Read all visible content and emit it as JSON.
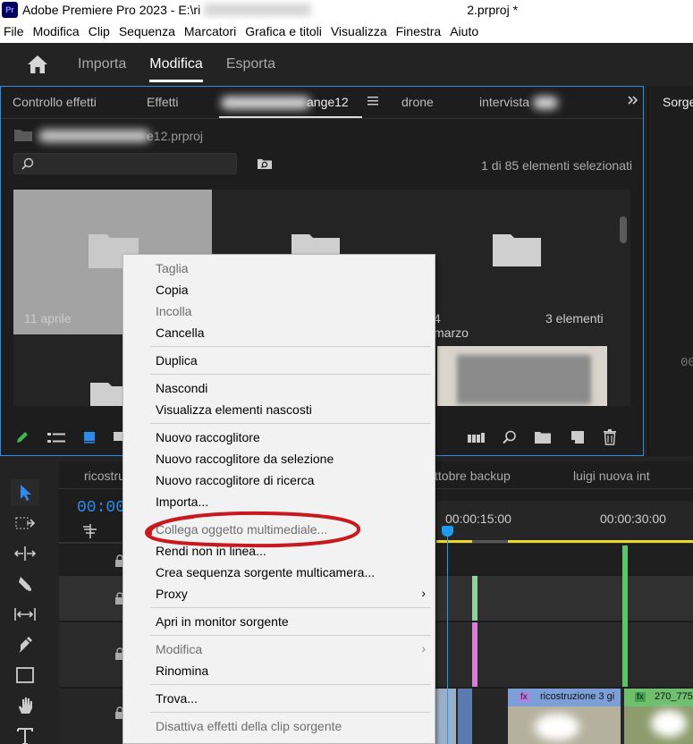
{
  "titlebar": {
    "app_title": "Adobe Premiere Pro 2023 - E:\\ri",
    "suffix": "2.prproj *"
  },
  "menubar": {
    "items": [
      "File",
      "Modifica",
      "Clip",
      "Sequenza",
      "Marcatori",
      "Grafica e titoli",
      "Visualizza",
      "Finestra",
      "Aiuto"
    ]
  },
  "workspace": {
    "tabs": [
      "Importa",
      "Modifica",
      "Esporta"
    ],
    "active": "Modifica"
  },
  "project_panel": {
    "tabs": [
      "Controllo effetti",
      "Effetti",
      "ange12",
      "drone",
      "intervista"
    ],
    "project_file": "e12.prproj",
    "selection_count": "1 di 85 elementi selezionati",
    "bins": [
      {
        "label": "11 aprile"
      },
      {
        "label": "4 marzo"
      },
      {
        "label": "3 elementi"
      }
    ]
  },
  "source_panel": {
    "title": "Sorge",
    "timecode": "00"
  },
  "timeline": {
    "tabs": [
      "ricostru",
      "ttobre backup",
      "luigi nuova int"
    ],
    "timecode": "00:00",
    "ruler_marks": [
      "00:00:15:00",
      "00:00:30:00"
    ],
    "clips": [
      {
        "label": "ricostruzione 3 gi",
        "badge": "fx"
      },
      {
        "label": "270_775",
        "badge": "fx"
      }
    ]
  },
  "context_menu": {
    "items": {
      "taglia": "Taglia",
      "copia": "Copia",
      "incolla": "Incolla",
      "cancella": "Cancella",
      "duplica": "Duplica",
      "nascondi": "Nascondi",
      "visualizza_nascosti": "Visualizza elementi nascosti",
      "nuovo_raccoglitore": "Nuovo raccoglitore",
      "nuovo_raccoglitore_selezione": "Nuovo raccoglitore da selezione",
      "nuovo_raccoglitore_ricerca": "Nuovo raccoglitore di ricerca",
      "importa": "Importa...",
      "collega": "Collega oggetto multimediale...",
      "rendi_non_in_linea": "Rendi non in linea...",
      "crea_multicamera": "Crea sequenza sorgente multicamera...",
      "proxy": "Proxy",
      "apri_monitor": "Apri in monitor sorgente",
      "modifica": "Modifica",
      "rinomina": "Rinomina",
      "trova": "Trova...",
      "disattiva_effetti": "Disattiva effetti della clip sorgente"
    }
  },
  "colors": {
    "accent_blue": "#2d8ceb",
    "annotation_red": "#c8191e",
    "playhead": "#1f9cf0",
    "clip_green": "#8fd19e"
  }
}
